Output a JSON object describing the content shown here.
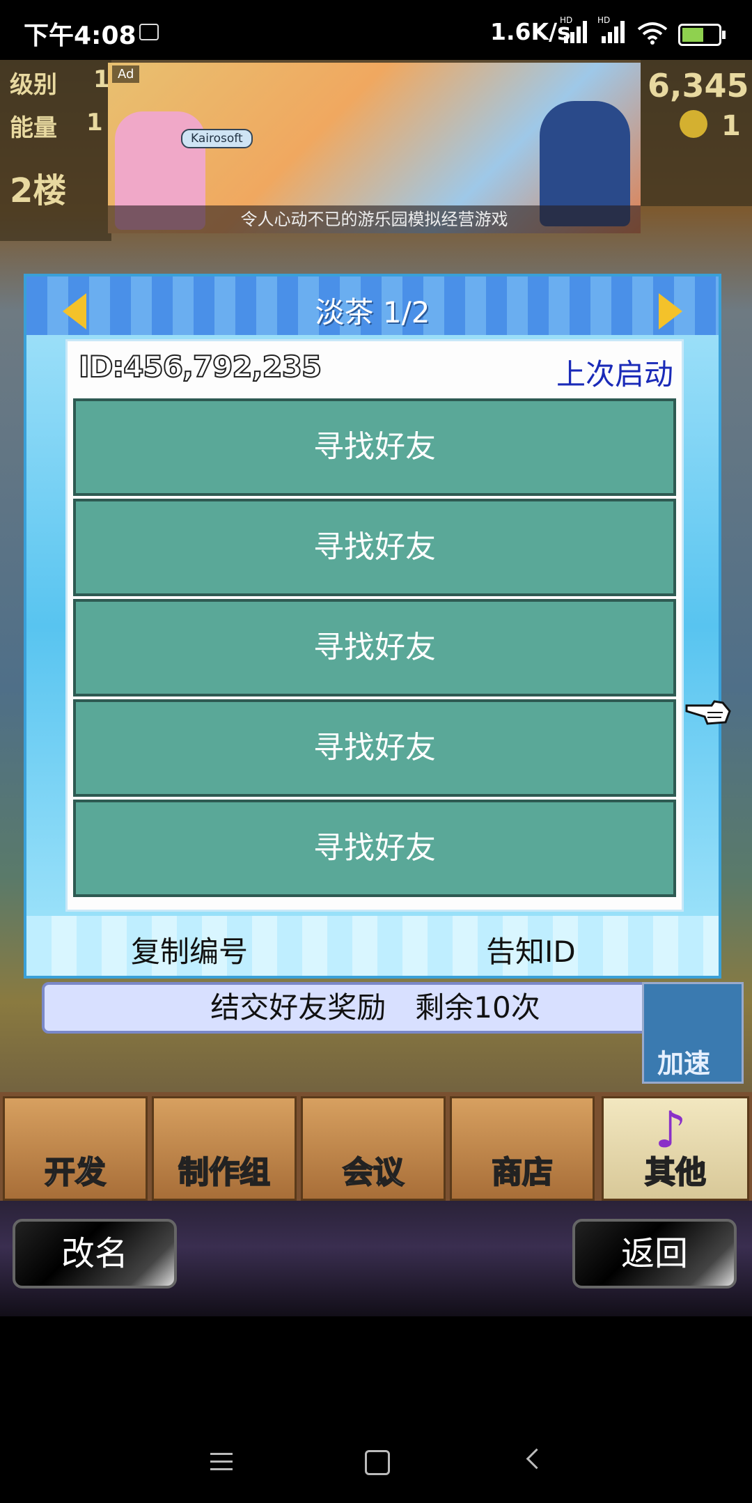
{
  "status_bar": {
    "time": "下午4:08",
    "net_speed": "1.6K/s",
    "sig1_label": "HD",
    "sig2_label": "HD"
  },
  "hud": {
    "level_label": "级别",
    "level_value": "1",
    "energy_label": "能量",
    "energy_value": "1",
    "floor": "2楼",
    "money": "6,345",
    "coins": "1"
  },
  "ad": {
    "label": "Ad",
    "brand": "Kairosoft",
    "caption": "令人心动不已的游乐园模拟经营游戏"
  },
  "dialog": {
    "title": "淡茶 1/2",
    "id_text": "ID:456,792,235",
    "last_launch": "上次启动",
    "friend_rows": [
      "寻找好友",
      "寻找好友",
      "寻找好友",
      "寻找好友",
      "寻找好友"
    ],
    "copy_button": "复制编号",
    "notify_button": "告知ID"
  },
  "reward": {
    "text": "结交好友奖励　剩余10次"
  },
  "speed_button": "加速",
  "menu": {
    "items": [
      "开发",
      "制作组",
      "会议",
      "商店",
      "其他"
    ]
  },
  "controls": {
    "rename": "改名",
    "back": "返回"
  },
  "colors": {
    "dialog_blue": "#58c4f0",
    "row_teal": "#5aa898",
    "title_text": "#ffffff",
    "last_launch_text": "#1a2ab8"
  }
}
